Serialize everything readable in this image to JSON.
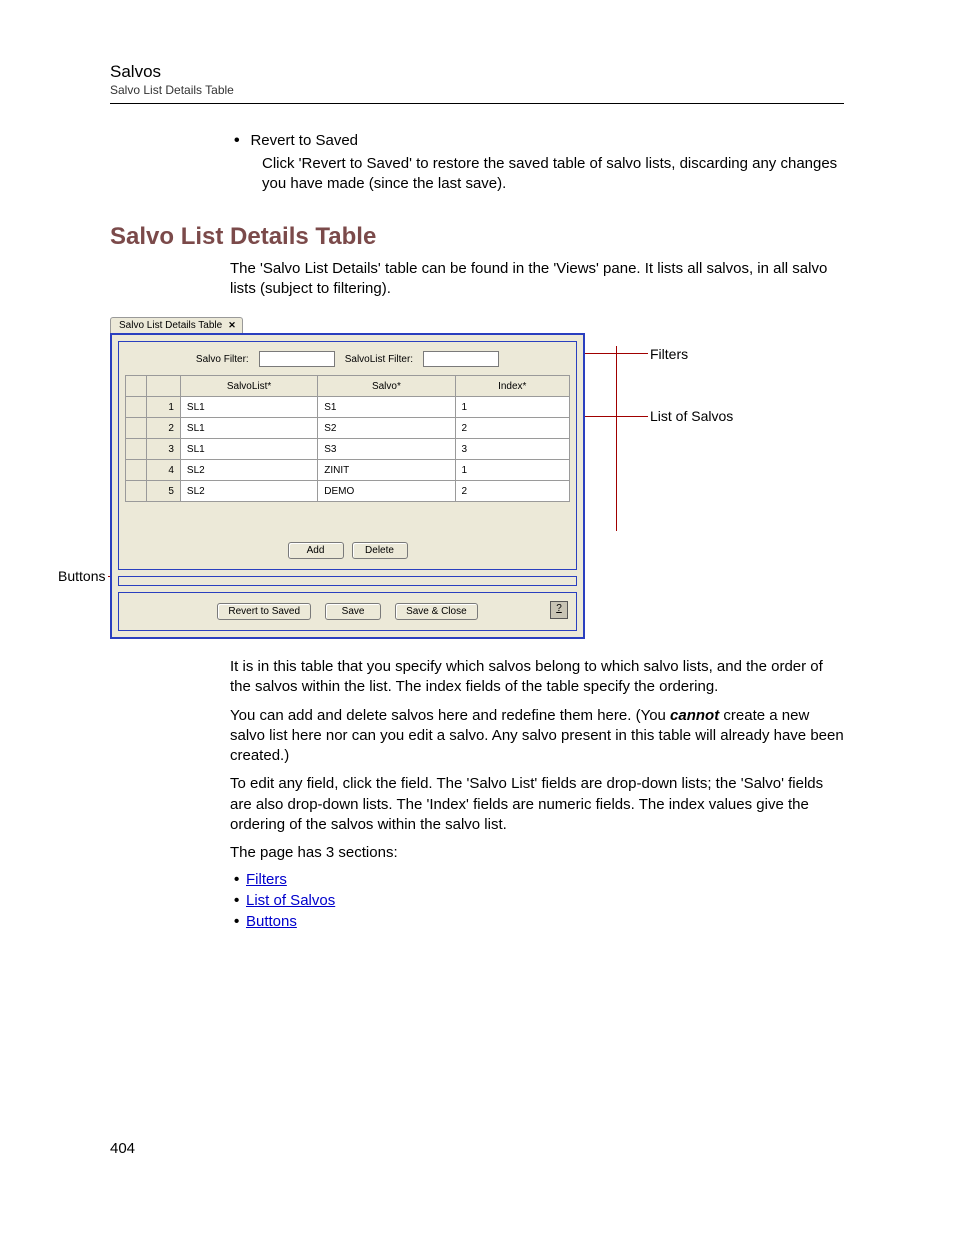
{
  "header": {
    "title": "Salvos",
    "subtitle": "Salvo List Details Table"
  },
  "revert": {
    "bullet": "Revert to Saved",
    "desc": "Click 'Revert to Saved' to restore the saved table of salvo lists, discarding any changes you have made (since the last save)."
  },
  "section_heading": "Salvo List Details Table",
  "intro": "The 'Salvo List Details' table can be found in the 'Views' pane. It lists all salvos, in all salvo lists (subject to filtering).",
  "screenshot": {
    "tab": "Salvo List Details Table",
    "filter1_label": "Salvo Filter:",
    "filter2_label": "SalvoList Filter:",
    "filter1_value": "",
    "filter2_value": "",
    "columns": [
      "SalvoList*",
      "Salvo*",
      "Index*"
    ],
    "rows": [
      {
        "n": "1",
        "list": "SL1",
        "salvo": "S1",
        "index": "1"
      },
      {
        "n": "2",
        "list": "SL1",
        "salvo": "S2",
        "index": "2"
      },
      {
        "n": "3",
        "list": "SL1",
        "salvo": "S3",
        "index": "3"
      },
      {
        "n": "4",
        "list": "SL2",
        "salvo": "ZINIT",
        "index": "1"
      },
      {
        "n": "5",
        "list": "SL2",
        "salvo": "DEMO",
        "index": "2"
      }
    ],
    "buttons": {
      "add": "Add",
      "delete": "Delete",
      "revert": "Revert to Saved",
      "save": "Save",
      "save_close": "Save & Close",
      "help": "?"
    }
  },
  "callouts": {
    "filters": "Filters",
    "list": "List of Salvos",
    "buttons": "Buttons"
  },
  "p_after1": "It is in this table that you specify which salvos belong to which salvo lists, and the order of the salvos within the list. The index fields of the table specify the ordering.",
  "p_after2a": "You can add and delete salvos here and redefine them here. (You ",
  "p_after2_em": "cannot",
  "p_after2b": " create a new salvo list here nor can you edit a salvo. Any salvo present in this table will already have been created.)",
  "p_after3": "To edit any field, click the field. The 'Salvo List' fields are drop-down lists; the 'Salvo' fields are also drop-down lists. The 'Index' fields are numeric fields. The index values give the ordering of the salvos within the salvo list.",
  "p_after4": "The page has 3 sections:",
  "links": {
    "filters": "Filters",
    "list": "List of Salvos",
    "buttons": "Buttons"
  },
  "page_number": "404"
}
